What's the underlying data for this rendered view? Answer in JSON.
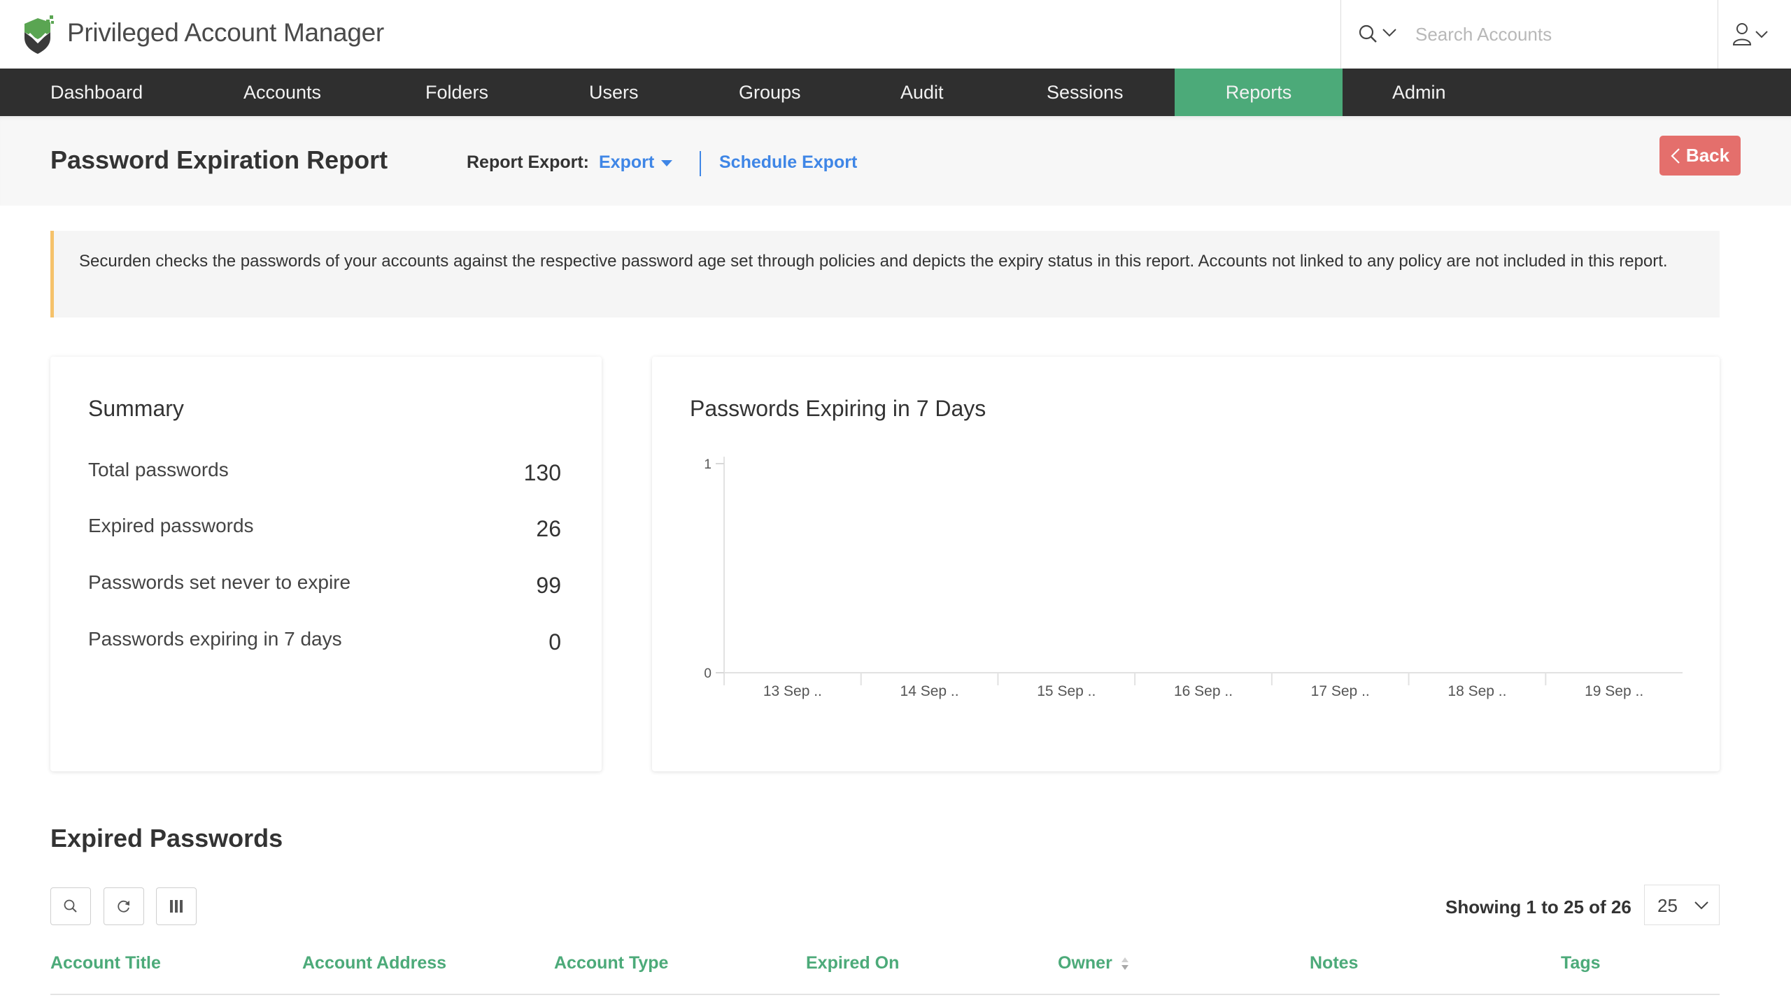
{
  "app": {
    "title": "Privileged Account Manager",
    "brand_color": "#4caa79"
  },
  "search": {
    "placeholder": "Search Accounts",
    "value": ""
  },
  "nav": {
    "items": [
      {
        "label": "Dashboard",
        "active": false
      },
      {
        "label": "Accounts",
        "active": false
      },
      {
        "label": "Folders",
        "active": false
      },
      {
        "label": "Users",
        "active": false
      },
      {
        "label": "Groups",
        "active": false
      },
      {
        "label": "Audit",
        "active": false
      },
      {
        "label": "Sessions",
        "active": false
      },
      {
        "label": "Reports",
        "active": true
      },
      {
        "label": "Admin",
        "active": false
      }
    ]
  },
  "page": {
    "title": "Password Expiration Report",
    "export_label": "Report Export:",
    "export_link": "Export",
    "schedule_link": "Schedule Export",
    "back_label": "Back"
  },
  "banner": {
    "text": "Securden checks the passwords of your accounts against the respective password age set through policies and depicts the expiry status in this report. Accounts not linked to any policy are not included in this report.",
    "accent_color": "#f5c26b"
  },
  "summary": {
    "title": "Summary",
    "rows": [
      {
        "label": "Total passwords",
        "value": "130"
      },
      {
        "label": "Expired passwords",
        "value": "26"
      },
      {
        "label": "Passwords set never to expire",
        "value": "99"
      },
      {
        "label": "Passwords expiring in 7 days",
        "value": "0"
      }
    ]
  },
  "chart_data": {
    "type": "bar",
    "title": "Passwords Expiring in 7 Days",
    "categories": [
      "13 Sep ..",
      "14 Sep ..",
      "15 Sep ..",
      "16 Sep ..",
      "17 Sep ..",
      "18 Sep ..",
      "19 Sep .."
    ],
    "values": [
      0,
      0,
      0,
      0,
      0,
      0,
      0
    ],
    "xlabel": "",
    "ylabel": "",
    "ylim": [
      0,
      1
    ],
    "yticks": [
      "0",
      "1"
    ],
    "grid": false,
    "legend": "none"
  },
  "expired": {
    "title": "Expired Passwords",
    "toolbar": {
      "search_icon": "search-icon",
      "refresh_icon": "refresh-icon",
      "columns_icon": "columns-icon"
    },
    "showing_text": "Showing 1 to 25 of 26",
    "page_size": "25",
    "columns": [
      {
        "label": "Account Title",
        "sortable": false
      },
      {
        "label": "Account Address",
        "sortable": false
      },
      {
        "label": "Account Type",
        "sortable": false
      },
      {
        "label": "Expired On",
        "sortable": false
      },
      {
        "label": "Owner",
        "sortable": true
      },
      {
        "label": "Notes",
        "sortable": false
      },
      {
        "label": "Tags",
        "sortable": false
      }
    ]
  }
}
